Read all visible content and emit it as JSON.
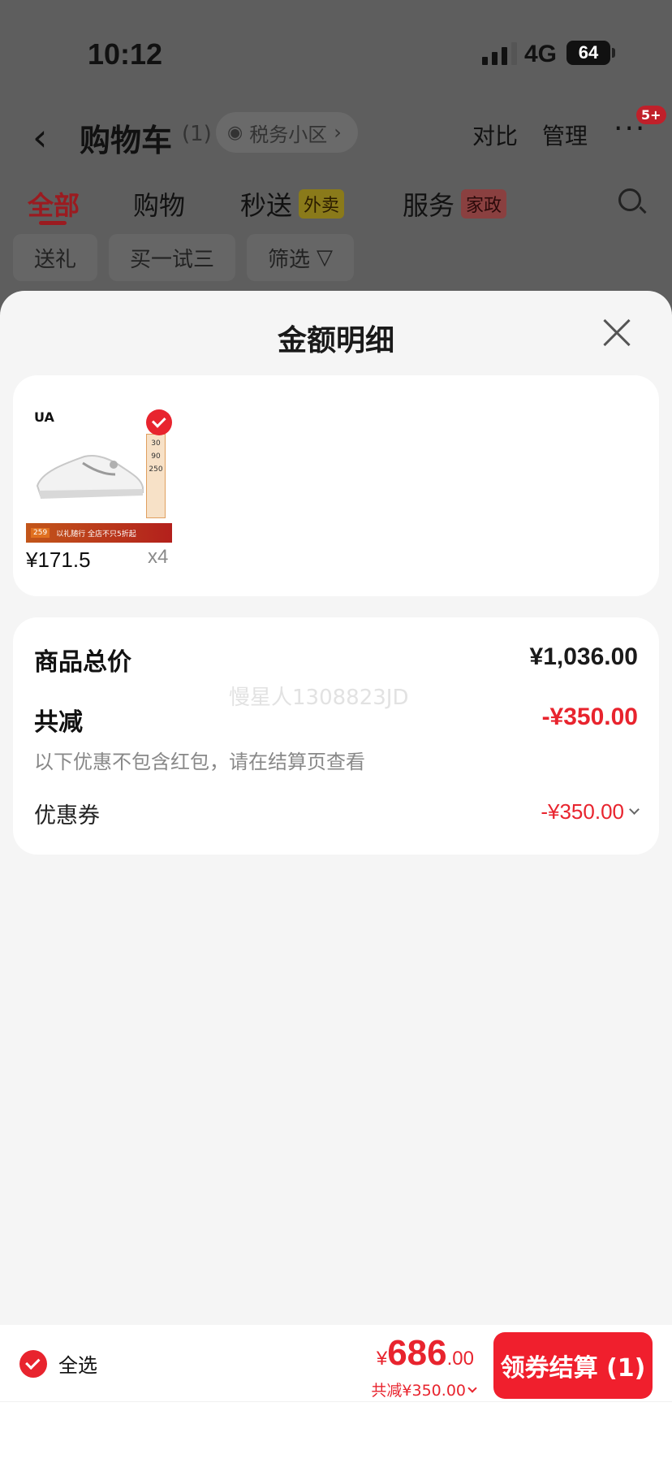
{
  "status_bar": {
    "time": "10:12",
    "network": "4G",
    "battery": "64"
  },
  "header": {
    "back_icon": "chevron-left-icon",
    "title": "购物车",
    "count": "(1)",
    "location": "税务小区",
    "compare": "对比",
    "manage": "管理",
    "more_icon": "more-dots-icon",
    "badge": "5+"
  },
  "tabs": [
    {
      "label": "全部",
      "active": true
    },
    {
      "label": "购物"
    },
    {
      "label": "秒送",
      "tag": "外卖"
    },
    {
      "label": "服务",
      "tag": "家政"
    }
  ],
  "filters": [
    "送礼",
    "买一试三",
    "筛选"
  ],
  "sheet": {
    "title": "金额明细",
    "product": {
      "brand": "UA",
      "price": "¥171.5",
      "qty": "x4",
      "promo_price": "259",
      "promo_text": "以礼随行 全店不只5折起"
    },
    "summary": {
      "total_label": "商品总价",
      "total_value": "¥1,036.00",
      "discount_label": "共减",
      "discount_value": "-¥350.00",
      "note": "以下优惠不包含红包，请在结算页查看",
      "coupon_label": "优惠券",
      "coupon_value": "-¥350.00",
      "watermark": "慢星人1308823JD"
    }
  },
  "bottom_bar": {
    "select_all": "全选",
    "currency": "¥",
    "total_int": "686",
    "total_dec": ".00",
    "total_sub": "共减¥350.00",
    "checkout": "领券结算 (1)"
  },
  "colors": {
    "accent": "#e8242e",
    "checkout": "#f01f2d",
    "sheet_bg": "#f5f5f5",
    "overlay": "#5e5e5e"
  }
}
